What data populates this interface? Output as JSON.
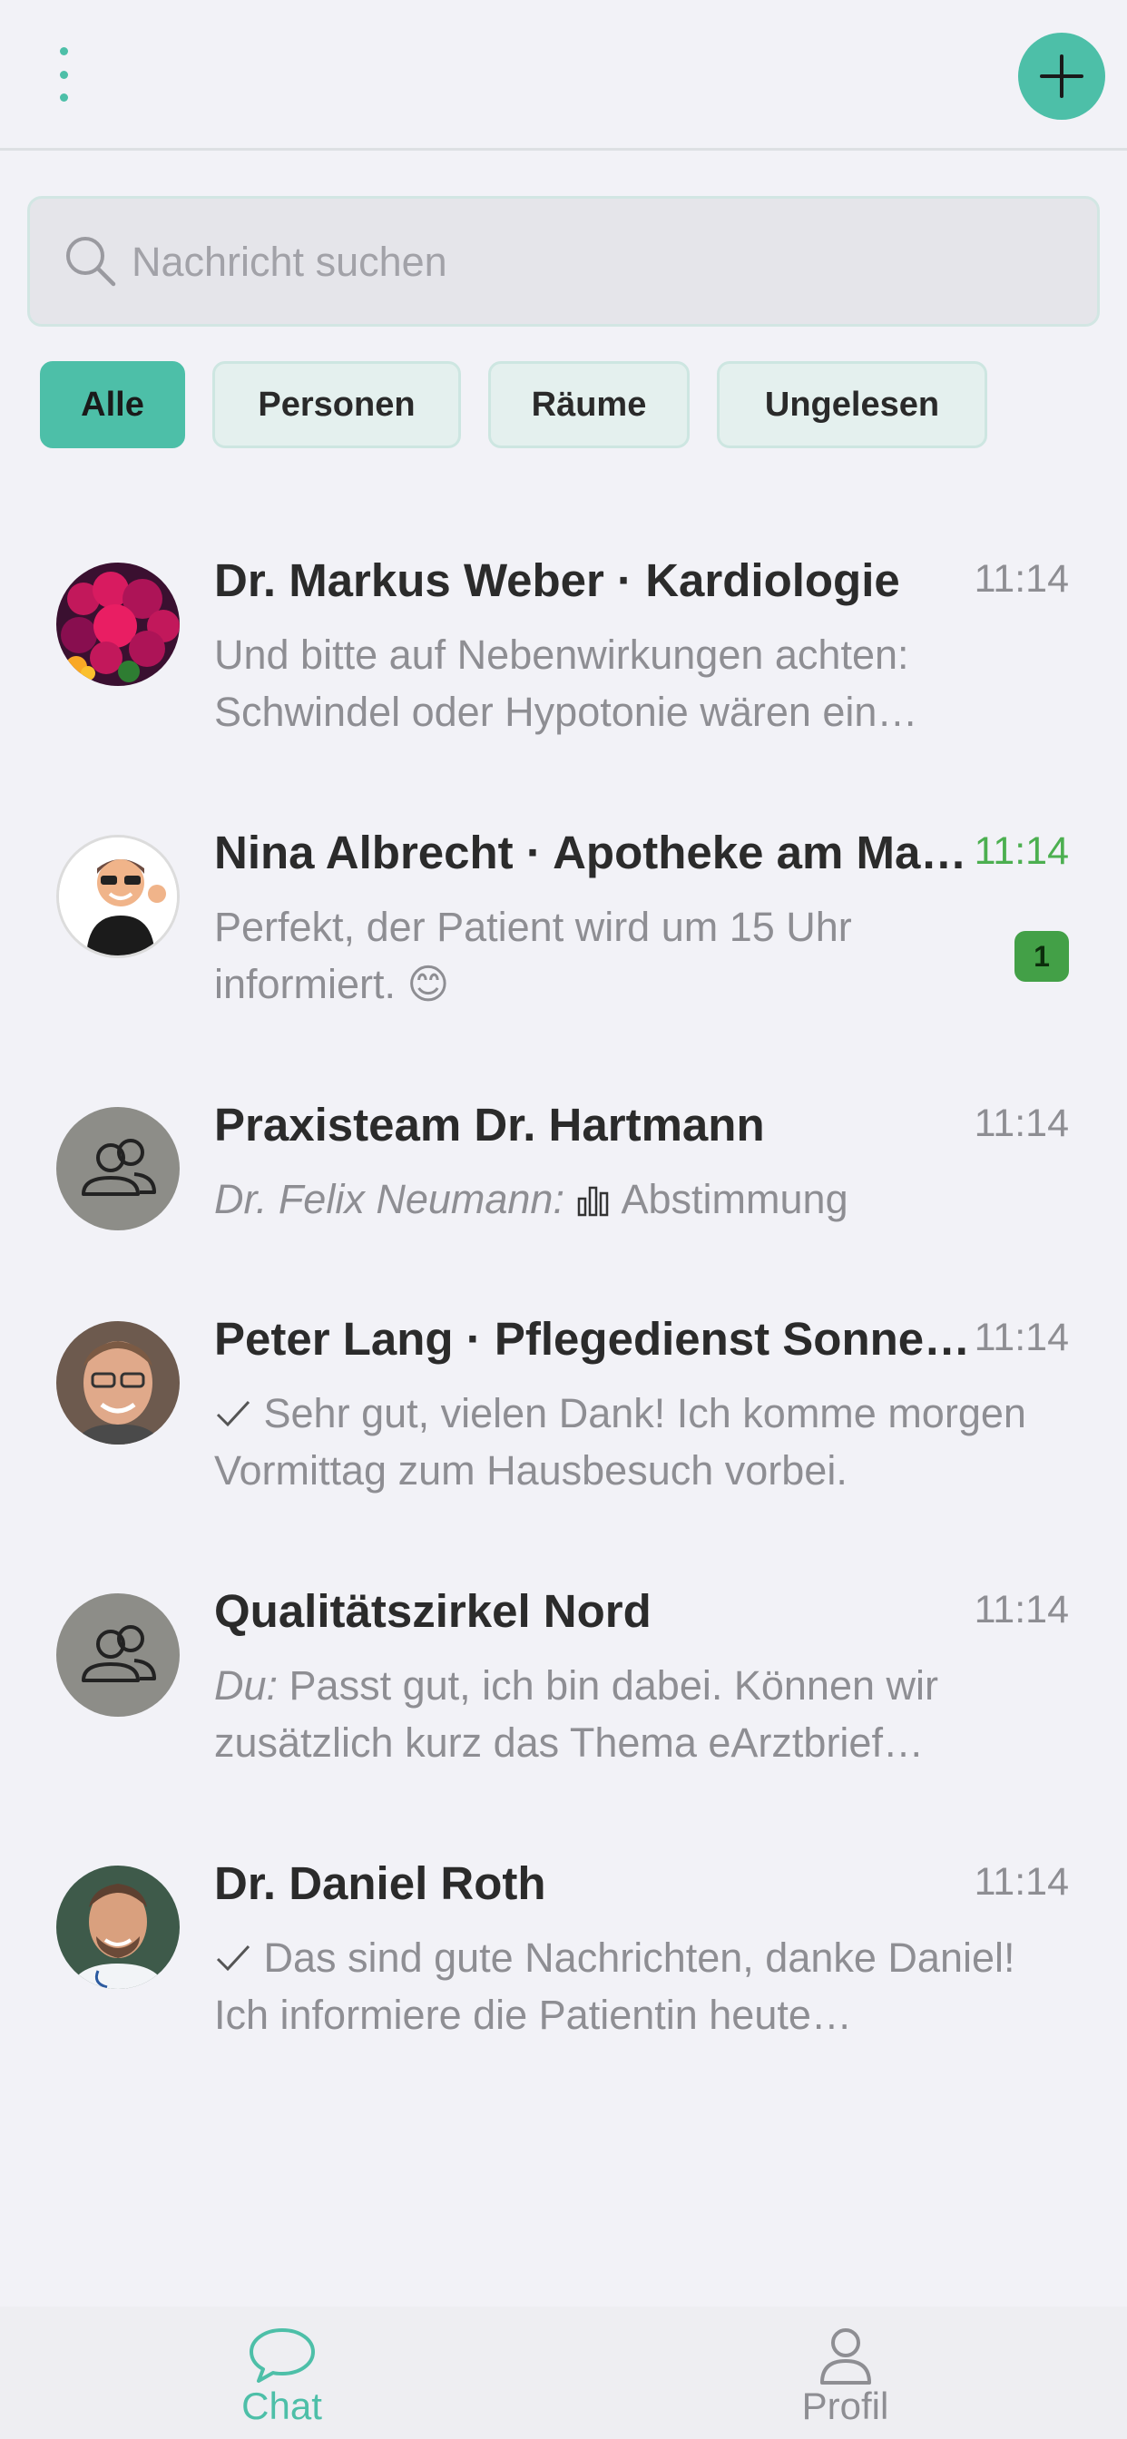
{
  "header": {
    "menu_icon": "more-vertical-icon",
    "add_icon": "plus-icon"
  },
  "search": {
    "placeholder": "Nachricht suchen",
    "value": ""
  },
  "filters": [
    {
      "label": "Alle",
      "active": true
    },
    {
      "label": "Personen",
      "active": false
    },
    {
      "label": "Räume",
      "active": false
    },
    {
      "label": "Ungelesen",
      "active": false
    }
  ],
  "chats": [
    {
      "name": "Dr. Markus Weber · Kardiologie",
      "time": "11:14",
      "preview": "Und bitte auf Nebenwirkungen achten: Schwindel oder Hypotonie wären ein…",
      "avatar": "flowers-photo"
    },
    {
      "name": "Nina Albrecht · Apotheke am Ma…",
      "time": "11:14",
      "preview": "Perfekt, der Patient wird um 15 Uhr informiert. 😊",
      "unread": "1",
      "avatar": "cartoon-man-photo"
    },
    {
      "name": "Praxisteam Dr. Hartmann",
      "time": "11:14",
      "sender": "Dr. Felix Neumann:",
      "preview": "Abstimmung",
      "avatar": "group-icon"
    },
    {
      "name": "Peter Lang · Pflegedienst Sonne…",
      "time": "11:14",
      "preview": "Sehr gut, vielen Dank! Ich komme morgen Vormittag zum Hausbesuch vorbei.",
      "avatar": "man-glasses-photo"
    },
    {
      "name": "Qualitätszirkel Nord",
      "time": "11:14",
      "sender": "Du:",
      "preview": "Passt gut, ich bin dabei. Können wir zusätzlich kurz das Thema eArztbrief…",
      "avatar": "group-icon"
    },
    {
      "name": "Dr. Daniel Roth",
      "time": "11:14",
      "preview": "Das sind gute Nachrichten, danke Daniel! Ich informiere die Patientin heute…",
      "avatar": "doctor-photo"
    }
  ],
  "tabbar": [
    {
      "label": "Chat",
      "icon": "chat-bubble-icon",
      "active": true
    },
    {
      "label": "Profil",
      "icon": "person-icon",
      "active": false
    }
  ],
  "colors": {
    "accent": "#4dbfa8",
    "unread_green": "#43a047",
    "background": "#f2f2f7"
  }
}
